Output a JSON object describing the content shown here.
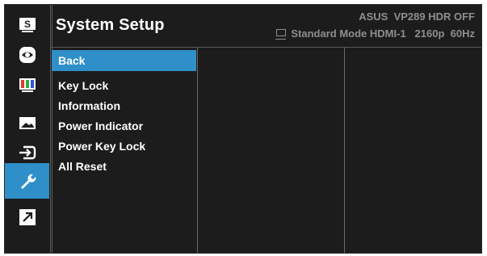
{
  "header": {
    "title": "System Setup",
    "brand_line": "ASUS  VP289 HDR OFF",
    "mode": "Standard Mode",
    "input": "HDMI-1",
    "resolution": "2160p",
    "refresh": "60Hz"
  },
  "sidebar": {
    "items": [
      {
        "icon": "splendid-icon",
        "label": "S"
      },
      {
        "icon": "eye-icon"
      },
      {
        "icon": "color-icon"
      },
      {
        "icon": "image-icon"
      },
      {
        "icon": "input-select-icon"
      },
      {
        "icon": "wrench-icon",
        "active": true
      },
      {
        "icon": "shortcut-icon"
      }
    ]
  },
  "menu": {
    "items": [
      "Back",
      "Key Lock",
      "Information",
      "Power Indicator",
      "Power Key Lock",
      "All Reset"
    ],
    "selected": "Back"
  },
  "colors": {
    "accent": "#2f8fc8",
    "panel": "#1c1c1c",
    "text": "#ffffff",
    "muted": "#8e8e8e"
  }
}
